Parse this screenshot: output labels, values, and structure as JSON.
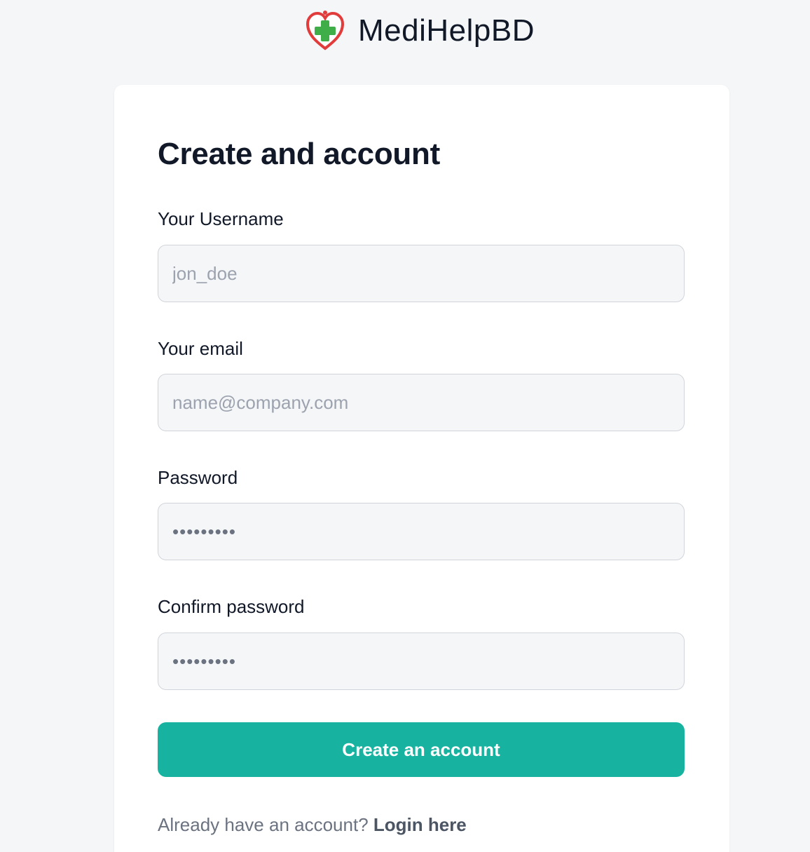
{
  "brand": {
    "name": "MediHelpBD",
    "logo_icon": "heart-cross-icon",
    "logo_colors": {
      "heart": "#e23b3b",
      "cross": "#3fae49"
    }
  },
  "form": {
    "title": "Create and account",
    "fields": [
      {
        "label": "Your Username",
        "placeholder": "jon_doe",
        "type": "text"
      },
      {
        "label": "Your email",
        "placeholder": "name@company.com",
        "type": "email"
      },
      {
        "label": "Password",
        "placeholder": "•••••••••",
        "type": "password"
      },
      {
        "label": "Confirm password",
        "placeholder": "•••••••••",
        "type": "password"
      }
    ],
    "submit_label": "Create an account",
    "login_prompt": "Already have an account? ",
    "login_link": "Login here"
  },
  "colors": {
    "accent": "#17b3a0",
    "page_bg": "#f5f6f8",
    "card_bg": "#ffffff"
  }
}
